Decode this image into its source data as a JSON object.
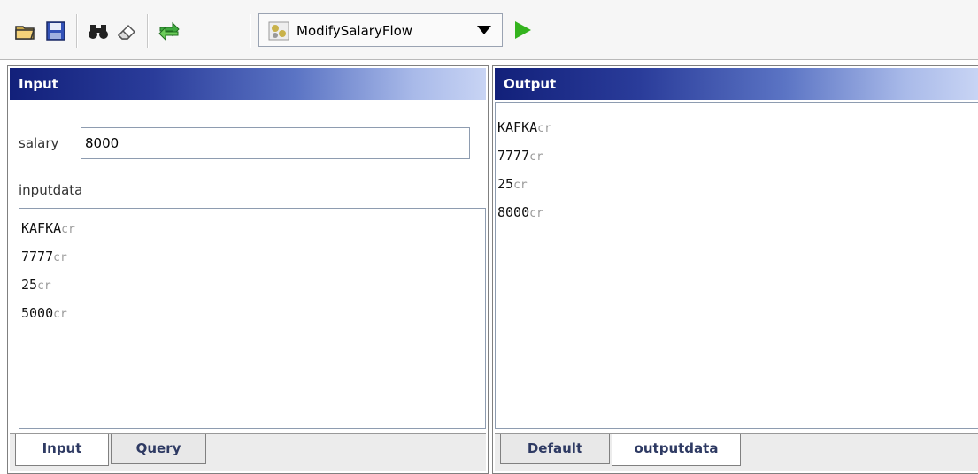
{
  "toolbar": {
    "flow_selector": {
      "value": "ModifySalaryFlow"
    },
    "icons": [
      "open-folder-icon",
      "save-icon",
      "find-icon",
      "eraser-icon",
      "transfer-icon",
      "flow-icon",
      "run-icon"
    ]
  },
  "input_pane": {
    "title": "Input",
    "salary_label": "salary",
    "salary_value": "8000",
    "inputdata_label": "inputdata",
    "inputdata_lines": [
      {
        "text": "KAFKA",
        "marker": "cr"
      },
      {
        "text": "7777",
        "marker": "cr"
      },
      {
        "text": "25",
        "marker": "cr"
      },
      {
        "text": "5000",
        "marker": "cr"
      }
    ],
    "tabs": [
      {
        "label": "Input"
      },
      {
        "label": "Query"
      }
    ]
  },
  "output_pane": {
    "title": "Output",
    "lines": [
      {
        "text": "KAFKA",
        "marker": "cr"
      },
      {
        "text": "7777",
        "marker": "cr"
      },
      {
        "text": "25",
        "marker": "cr"
      },
      {
        "text": "8000",
        "marker": "cr"
      }
    ],
    "tabs": [
      {
        "label": "Default"
      },
      {
        "label": "outputdata"
      }
    ]
  },
  "colors": {
    "header_gradient_start": "#12207a",
    "header_gradient_end": "#c8d4f4",
    "run_green": "#34b31e",
    "tab_text": "#2e3a63"
  }
}
